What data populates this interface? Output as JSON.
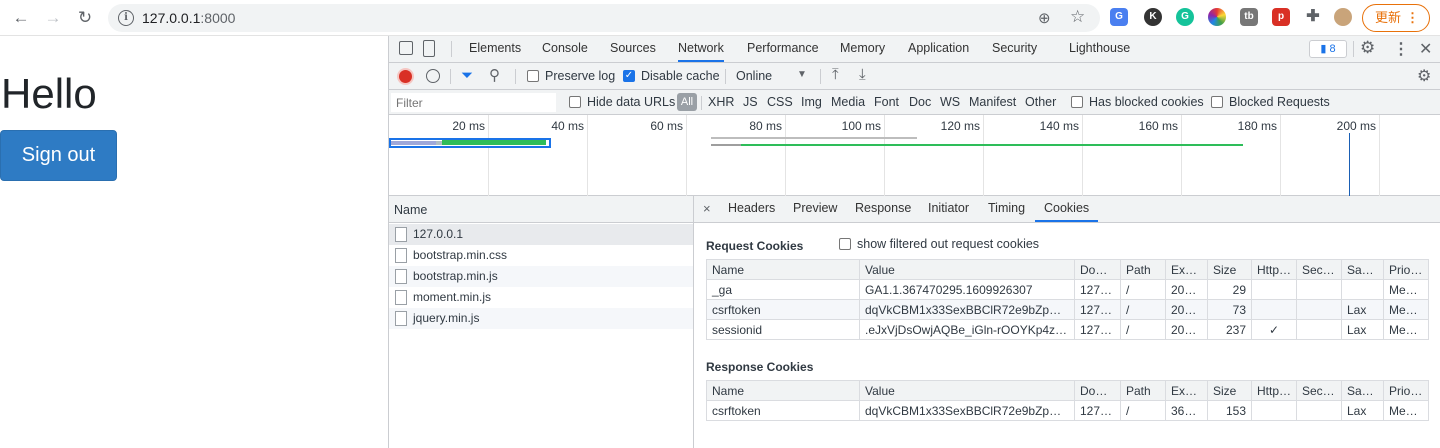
{
  "browser": {
    "url_host": "127.0.0.1",
    "url_port": ":8000",
    "update_label": "更新",
    "extensions": [
      {
        "name": "translate-icon",
        "color": "#4a7ff0",
        "glyph": "G"
      },
      {
        "name": "k-extension-icon",
        "color": "#333333",
        "glyph": "K"
      },
      {
        "name": "grammarly-icon",
        "color": "#15c39a",
        "glyph": "G"
      },
      {
        "name": "color-wheel-icon",
        "color": "#e44",
        "glyph": "●"
      },
      {
        "name": "tb-extension-icon",
        "color": "#666666",
        "glyph": "tb"
      },
      {
        "name": "pdf-extension-icon",
        "color": "#d93025",
        "glyph": "p"
      }
    ]
  },
  "page": {
    "heading": "Hello",
    "signout_label": "Sign out"
  },
  "devtools": {
    "tabs": [
      "Elements",
      "Console",
      "Sources",
      "Network",
      "Performance",
      "Memory",
      "Application",
      "Security",
      "Lighthouse"
    ],
    "active_tab": "Network",
    "messages_count": "8",
    "toolbar": {
      "preserve_log": "Preserve log",
      "disable_cache": "Disable cache",
      "throttle": "Online"
    },
    "filter": {
      "placeholder": "Filter",
      "hide_data_urls": "Hide data URLs",
      "types": [
        "All",
        "XHR",
        "JS",
        "CSS",
        "Img",
        "Media",
        "Font",
        "Doc",
        "WS",
        "Manifest",
        "Other"
      ],
      "has_blocked_cookies": "Has blocked cookies",
      "blocked_requests": "Blocked Requests"
    },
    "overview_ticks": [
      "20 ms",
      "40 ms",
      "60 ms",
      "80 ms",
      "100 ms",
      "120 ms",
      "140 ms",
      "160 ms",
      "180 ms",
      "200 ms"
    ],
    "name_header": "Name",
    "requests": [
      "127.0.0.1",
      "bootstrap.min.css",
      "bootstrap.min.js",
      "moment.min.js",
      "jquery.min.js"
    ],
    "detail_tabs": [
      "Headers",
      "Preview",
      "Response",
      "Initiator",
      "Timing",
      "Cookies"
    ],
    "active_detail_tab": "Cookies",
    "request_cookies_title": "Request Cookies",
    "show_filtered": "show filtered out request cookies",
    "response_cookies_title": "Response Cookies",
    "columns": [
      "Name",
      "Value",
      "Do…",
      "Path",
      "Exp…",
      "Size",
      "Http…",
      "Sec…",
      "Sa…",
      "Prio…"
    ],
    "request_cookies": [
      [
        "_ga",
        "GA1.1.367470295.1609926307",
        "127…",
        "/",
        "202…",
        "29",
        "",
        "",
        "",
        "Me…"
      ],
      [
        "csrftoken",
        "dqVkCBM1x33SexBBClR72e9bZpV…",
        "127…",
        "/",
        "202…",
        "73",
        "",
        "",
        "Lax",
        "Me…"
      ],
      [
        "sessionid",
        ".eJxVjDsOwjAQBe_iGln-rOOYKp4z…",
        "127…",
        "/",
        "202…",
        "237",
        "✓",
        "",
        "Lax",
        "Me…"
      ]
    ],
    "response_cookies": [
      [
        "csrftoken",
        "dqVkCBM1x33SexBBClR72e9bZpV…",
        "127…",
        "/",
        "364…",
        "153",
        "",
        "",
        "Lax",
        "Me…"
      ]
    ]
  }
}
